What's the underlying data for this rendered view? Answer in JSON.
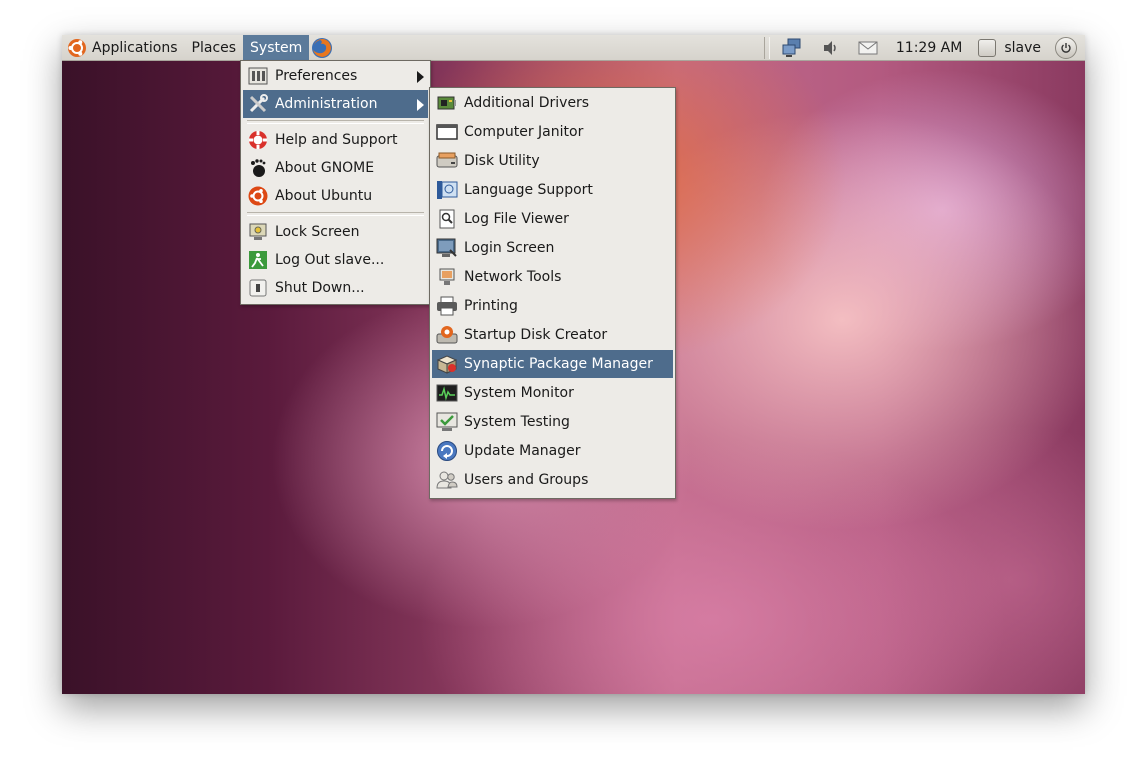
{
  "panel": {
    "menus": [
      "Applications",
      "Places",
      "System"
    ],
    "active_menu": "System",
    "clock": "11:29 AM",
    "user": "slave",
    "icons": [
      "ubuntu-logo-icon",
      "firefox-icon",
      "network-icon",
      "volume-icon",
      "mail-icon",
      "power-icon"
    ]
  },
  "system_menu": {
    "items": [
      {
        "label": "Preferences",
        "icon": "preferences-icon",
        "submenu": true
      },
      {
        "label": "Administration",
        "icon": "administration-icon",
        "submenu": true,
        "highlighted": true
      },
      {
        "label": "Help and Support",
        "icon": "help-icon"
      },
      {
        "label": "About GNOME",
        "icon": "gnome-foot-icon"
      },
      {
        "label": "About Ubuntu",
        "icon": "ubuntu-icon"
      },
      {
        "label": "Lock Screen",
        "icon": "lock-icon"
      },
      {
        "label": "Log Out slave...",
        "icon": "logout-icon"
      },
      {
        "label": "Shut Down...",
        "icon": "shutdown-icon"
      }
    ]
  },
  "admin_menu": {
    "items": [
      {
        "label": "Additional Drivers",
        "icon": "drivers-icon"
      },
      {
        "label": "Computer Janitor",
        "icon": "janitor-icon"
      },
      {
        "label": "Disk Utility",
        "icon": "disk-icon"
      },
      {
        "label": "Language Support",
        "icon": "language-icon"
      },
      {
        "label": "Log File Viewer",
        "icon": "log-viewer-icon"
      },
      {
        "label": "Login Screen",
        "icon": "login-screen-icon"
      },
      {
        "label": "Network Tools",
        "icon": "network-tools-icon"
      },
      {
        "label": "Printing",
        "icon": "printer-icon"
      },
      {
        "label": "Startup Disk Creator",
        "icon": "startup-disk-icon"
      },
      {
        "label": "Synaptic Package Manager",
        "icon": "synaptic-icon",
        "highlighted": true
      },
      {
        "label": "System Monitor",
        "icon": "system-monitor-icon"
      },
      {
        "label": "System Testing",
        "icon": "system-testing-icon"
      },
      {
        "label": "Update Manager",
        "icon": "update-manager-icon"
      },
      {
        "label": "Users and Groups",
        "icon": "users-groups-icon"
      }
    ]
  },
  "colors": {
    "panel_bg": "#dcd9d3",
    "menu_bg": "#edebe7",
    "highlight": "#4e6c8c"
  }
}
